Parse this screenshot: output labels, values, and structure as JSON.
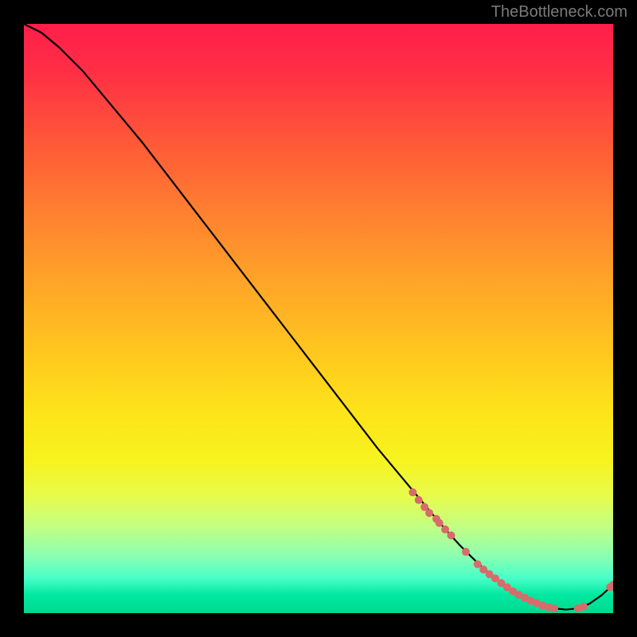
{
  "watermark": "TheBottleneck.com",
  "chart_data": {
    "type": "line",
    "title": "",
    "xlabel": "",
    "ylabel": "",
    "xlim": [
      0,
      100
    ],
    "ylim": [
      0,
      100
    ],
    "grid": false,
    "legend": false,
    "series": [
      {
        "name": "curve",
        "color": "#000000",
        "x": [
          0,
          3,
          6,
          10,
          15,
          20,
          25,
          30,
          35,
          40,
          45,
          50,
          55,
          60,
          65,
          70,
          72,
          74,
          76,
          78,
          80,
          82,
          84,
          86,
          88,
          90,
          92,
          94,
          96,
          98,
          100
        ],
        "y": [
          100,
          98.5,
          96,
          92,
          86,
          80,
          73.5,
          67,
          60.5,
          54,
          47.5,
          41,
          34.5,
          28,
          22,
          16,
          13.7,
          11.5,
          9.5,
          7.6,
          5.9,
          4.4,
          3.1,
          2.1,
          1.3,
          0.8,
          0.6,
          0.8,
          1.6,
          3.0,
          4.8
        ]
      }
    ],
    "scatter_points": {
      "color": "#d86b6b",
      "radius": 5,
      "x": [
        66,
        67,
        68,
        68.8,
        70,
        70.5,
        71.5,
        72.5,
        75,
        77,
        78,
        79,
        80,
        81,
        82,
        83,
        84,
        85,
        86,
        87,
        88,
        89,
        90,
        94,
        95,
        99.5,
        100
      ],
      "y": [
        20.5,
        19.2,
        18,
        17,
        16,
        15.3,
        14.2,
        13.2,
        10.4,
        8.3,
        7.4,
        6.6,
        5.9,
        5.1,
        4.4,
        3.7,
        3.1,
        2.6,
        2.1,
        1.7,
        1.3,
        1.0,
        0.8,
        0.8,
        1.1,
        4.4,
        4.8
      ]
    },
    "gradient": {
      "stops": [
        {
          "pos": 0.0,
          "color": "#ff1e4a"
        },
        {
          "pos": 0.2,
          "color": "#ff5838"
        },
        {
          "pos": 0.44,
          "color": "#ffa528"
        },
        {
          "pos": 0.66,
          "color": "#fde41a"
        },
        {
          "pos": 0.85,
          "color": "#c5ff80"
        },
        {
          "pos": 1.0,
          "color": "#00d98e"
        }
      ]
    }
  }
}
